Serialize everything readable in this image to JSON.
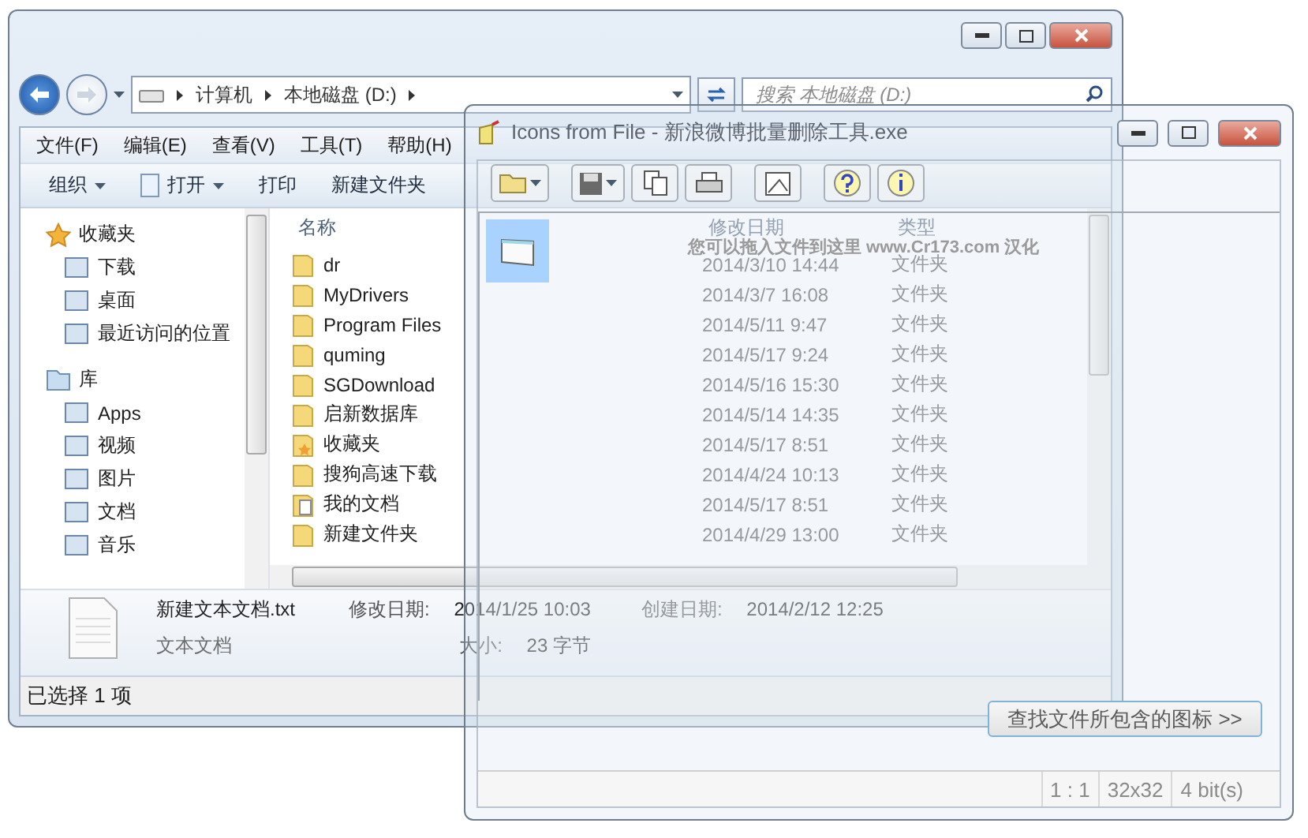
{
  "explorer": {
    "address": {
      "crumbs": [
        "计算机",
        "本地磁盘 (D:)"
      ]
    },
    "search": {
      "placeholder": "搜索 本地磁盘 (D:)"
    },
    "menu": [
      "文件(F)",
      "编辑(E)",
      "查看(V)",
      "工具(T)",
      "帮助(H)"
    ],
    "toolbar": [
      {
        "label": "组织",
        "kind": "dropdown"
      },
      {
        "label": "打开",
        "kind": "dropdown"
      },
      {
        "label": "打印",
        "kind": "plain"
      },
      {
        "label": "新建文件夹",
        "kind": "plain"
      }
    ],
    "nav": [
      {
        "label": "收藏夹",
        "children": [
          {
            "label": "下载"
          },
          {
            "label": "桌面"
          },
          {
            "label": "最近访问的位置"
          }
        ]
      },
      {
        "label": "库",
        "children": [
          {
            "label": "Apps"
          },
          {
            "label": "视频"
          },
          {
            "label": "图片"
          },
          {
            "label": "文档"
          },
          {
            "label": "音乐"
          }
        ]
      }
    ],
    "columns": [
      "名称",
      "修改日期",
      "类型"
    ],
    "rows": [
      {
        "name": "dr",
        "date": "2014/3/10 14:44",
        "type": "文件夹",
        "kind": "folder"
      },
      {
        "name": "MyDrivers",
        "date": "2014/3/7 16:08",
        "type": "文件夹",
        "kind": "folder"
      },
      {
        "name": "Program Files",
        "date": "2014/5/11 9:47",
        "type": "文件夹",
        "kind": "folder"
      },
      {
        "name": "quming",
        "date": "2014/5/17 9:24",
        "type": "文件夹",
        "kind": "folder"
      },
      {
        "name": "SGDownload",
        "date": "2014/5/16 15:30",
        "type": "文件夹",
        "kind": "folder"
      },
      {
        "name": "启新数据库",
        "date": "2014/5/14 14:35",
        "type": "文件夹",
        "kind": "folder"
      },
      {
        "name": "收藏夹",
        "date": "2014/5/17 8:51",
        "type": "文件夹",
        "kind": "favorites"
      },
      {
        "name": "搜狗高速下载",
        "date": "2014/4/24 10:13",
        "type": "文件夹",
        "kind": "folder"
      },
      {
        "name": "我的文档",
        "date": "2014/5/17 8:51",
        "type": "文件夹",
        "kind": "documents"
      },
      {
        "name": "新建文件夹",
        "date": "2014/4/29 13:00",
        "type": "文件夹",
        "kind": "folder"
      }
    ],
    "details": {
      "filename": "新建文本文档.txt",
      "filetype": "文本文档",
      "fields": [
        {
          "label": "修改日期:",
          "value": "2014/1/25 10:03"
        },
        {
          "label": "大小:",
          "value": "23 字节"
        },
        {
          "label": "创建日期:",
          "value": "2014/2/12 12:25"
        }
      ]
    },
    "status_bar": "已选择 1 项"
  },
  "overlay": {
    "title": "Icons from File - 新浪微博批量删除工具.exe",
    "icons": [
      {
        "selected": true
      }
    ],
    "hint": "您可以拖入文件到这里 www.Cr173.com 汉化",
    "button": "查找文件所包含的图标 >>",
    "status_bar": [
      "1 : 1",
      "32x32",
      "4 bit(s)"
    ]
  }
}
